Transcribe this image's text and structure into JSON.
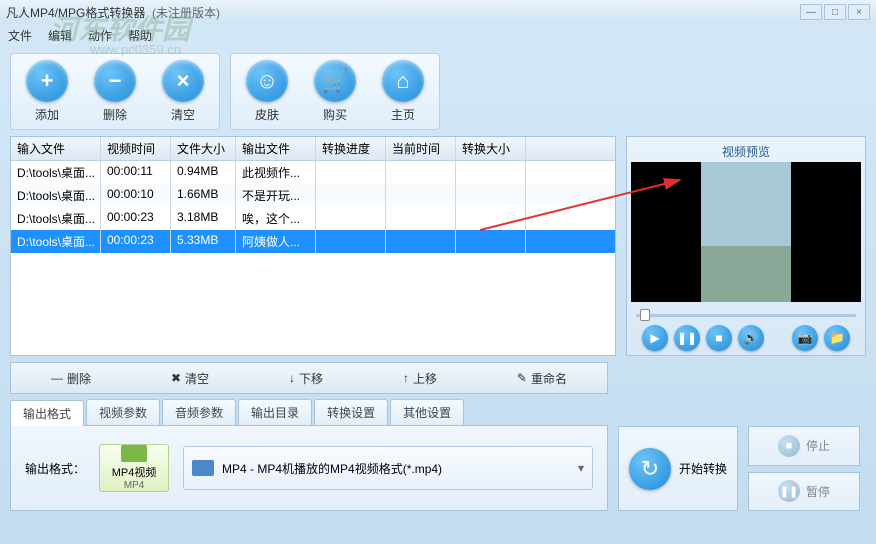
{
  "window": {
    "title": "凡人MP4/MPG格式转换器",
    "unreg": "(未注册版本)"
  },
  "menu": {
    "file": "文件",
    "edit": "编辑",
    "action": "动作",
    "help": "帮助"
  },
  "toolbar": {
    "add": "添加",
    "del": "删除",
    "clear": "清空",
    "skin": "皮肤",
    "buy": "购买",
    "home": "主页"
  },
  "watermark": {
    "text": "河东软件园",
    "url": "www.pc0359.cn"
  },
  "table": {
    "cols": [
      "输入文件",
      "视频时间",
      "文件大小",
      "输出文件",
      "转换进度",
      "当前时间",
      "转换大小"
    ],
    "rows": [
      [
        "D:\\tools\\桌面...",
        "00:00:11",
        "0.94MB",
        "此视频作...",
        "",
        "",
        ""
      ],
      [
        "D:\\tools\\桌面...",
        "00:00:10",
        "1.66MB",
        "不是开玩...",
        "",
        "",
        ""
      ],
      [
        "D:\\tools\\桌面...",
        "00:00:23",
        "3.18MB",
        "唉，这个...",
        "",
        "",
        ""
      ],
      [
        "D:\\tools\\桌面...",
        "00:00:23",
        "5.33MB",
        "阿姨做人...",
        "",
        "",
        ""
      ]
    ],
    "selected": 3
  },
  "listops": {
    "del": "删除",
    "clear": "清空",
    "down": "下移",
    "up": "上移",
    "rename": "重命名"
  },
  "preview": {
    "title": "视频预览"
  },
  "tabs": [
    "输出格式",
    "视频参数",
    "音频参数",
    "输出目录",
    "转换设置",
    "其他设置"
  ],
  "output": {
    "label": "输出格式：",
    "fmt_title": "MP4视频",
    "fmt_sub": "MP4",
    "dropdown": "MP4 - MP4机播放的MP4视频格式(*.mp4)"
  },
  "convert": {
    "start": "开始转换",
    "stop": "停止",
    "pause": "暂停"
  }
}
